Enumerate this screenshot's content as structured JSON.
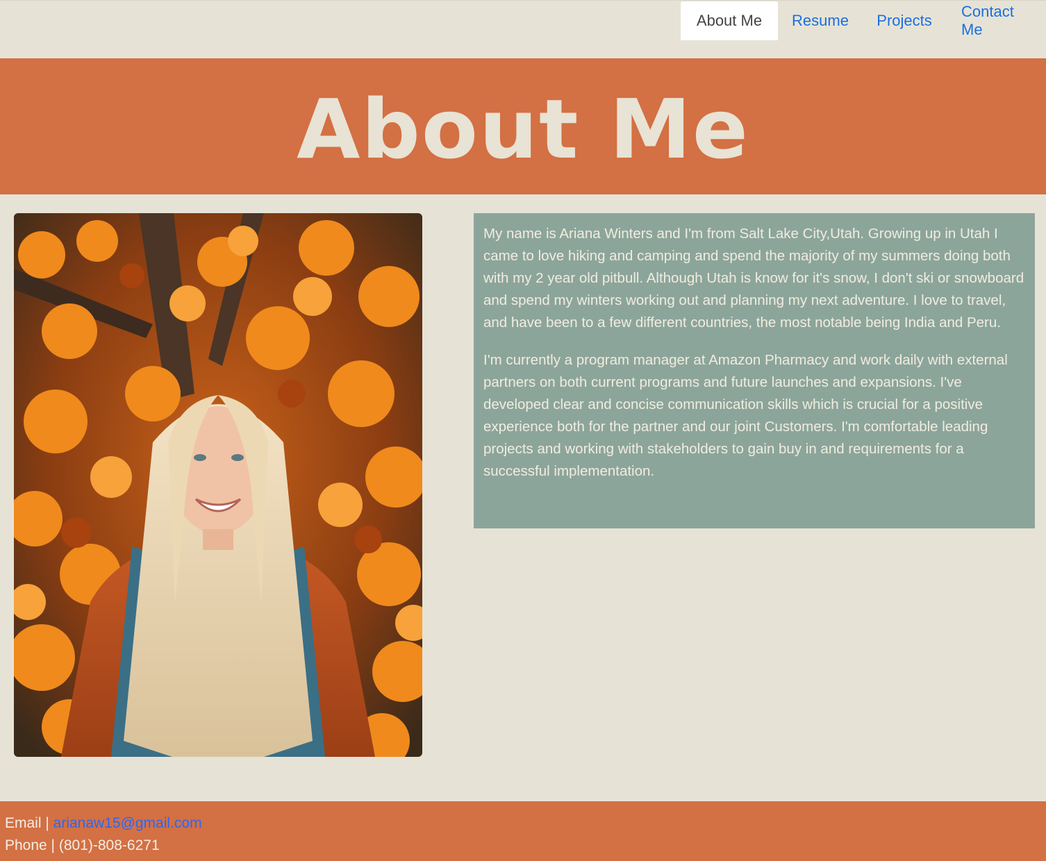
{
  "nav": {
    "tabs": [
      {
        "label": "About Me",
        "active": true
      },
      {
        "label": "Resume",
        "active": false
      },
      {
        "label": "Projects",
        "active": false
      },
      {
        "label": "Contact Me",
        "active": false
      }
    ]
  },
  "hero": {
    "title": "About Me"
  },
  "profile_photo": {
    "alt": "Photo of Ariana Winters in front of autumn leaves"
  },
  "bio": {
    "paragraphs": [
      "My name is Ariana Winters and I'm from Salt Lake City,Utah. Growing up in Utah I came to love hiking and camping and spend the majority of my summers doing both with my 2 year old pitbull. Although Utah is know for it's snow, I don't ski or snowboard and spend my winters working out and planning my next adventure. I love to travel, and have been to a few different countries, the most notable being India and Peru.",
      "I'm currently a program manager at Amazon Pharmacy and work daily with external partners on both current programs and future launches and expansions. I've developed clear and concise communication skills which is crucial for a positive experience both for the partner and our joint Customers. I'm comfortable leading projects and working with stakeholders to gain buy in and requirements for a successful implementation."
    ]
  },
  "footer": {
    "email_label": "Email |",
    "email": "arianaw15@gmail.com",
    "phone_label": "Phone |",
    "phone": "(801)-808-6271"
  },
  "colors": {
    "background": "#e6e3d6",
    "accent": "#d37044",
    "bio_box": "#8ca59b",
    "link": "#1b6fe0"
  }
}
